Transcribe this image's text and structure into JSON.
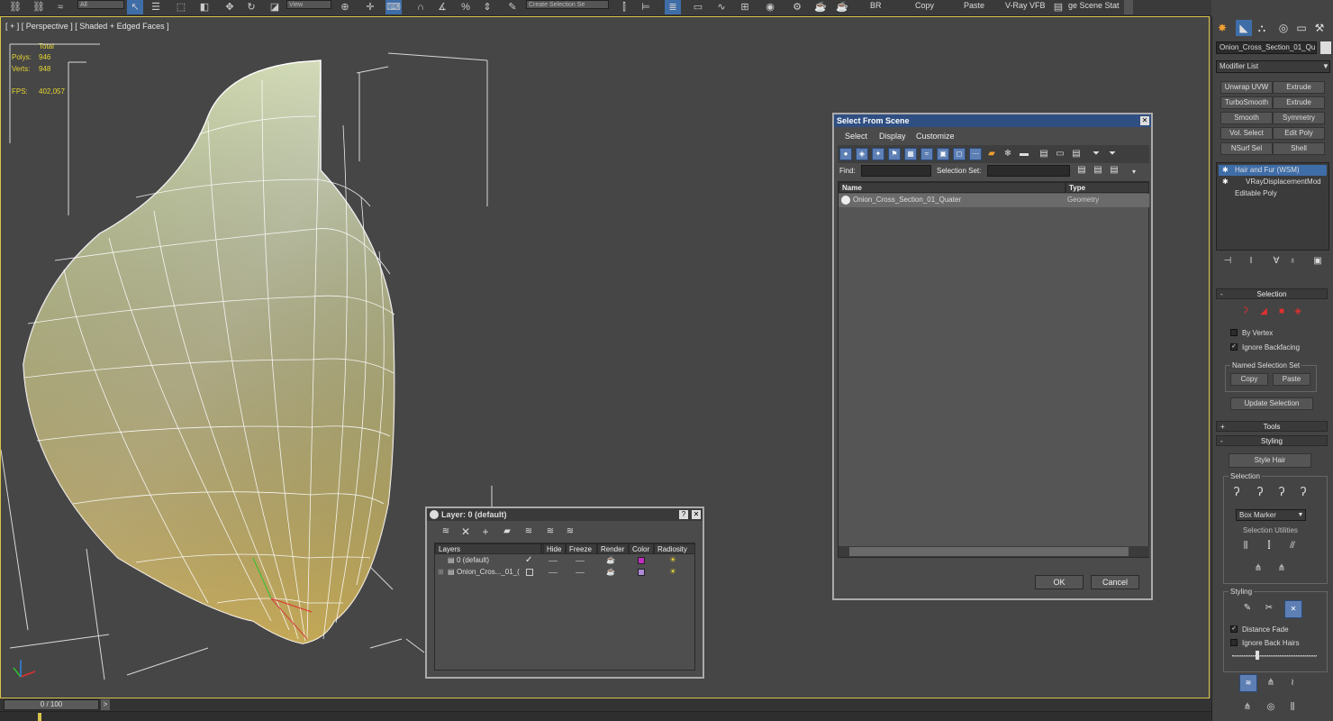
{
  "toolbar": {
    "filter_value": "All",
    "view_value": "View",
    "selection_set_placeholder": "Create Selection Se",
    "labels": [
      "BR",
      "Copy",
      "Paste",
      "V-Ray VFB",
      "ge Scene Stat"
    ]
  },
  "viewport": {
    "label": "[ + ] [ Perspective ] [ Shaded + Edged Faces ]",
    "stats": {
      "total_label": "Total",
      "polys_label": "Polys:",
      "polys_value": "946",
      "verts_label": "Verts:",
      "verts_value": "948",
      "fps_label": "FPS:",
      "fps_value": "402,057"
    }
  },
  "timeline": {
    "frame_display": "0 / 100",
    "next_label": ">",
    "prev_label": "<"
  },
  "command_panel": {
    "object_name": "Onion_Cross_Section_01_Qu",
    "modifier_list_label": "Modifier List",
    "modifier_buttons": [
      "Unwrap UVW",
      "Extrude",
      "TurboSmooth",
      "Extrude",
      "Smooth",
      "Symmetry",
      "Vol. Select",
      "Edit Poly",
      "NSurf Sel",
      "Shell"
    ],
    "stack": [
      "Hair and Fur (WSM)",
      "VRayDisplacementMod",
      "Editable Poly"
    ],
    "selection_rollout": {
      "title": "Selection",
      "sign": "-",
      "by_vertex": "By Vertex",
      "ignore_backfacing": "Ignore Backfacing",
      "named_selection_set": "Named Selection Set",
      "copy": "Copy",
      "paste": "Paste",
      "update_selection": "Update Selection"
    },
    "tools_rollout": {
      "title": "Tools",
      "sign": "+"
    },
    "styling_rollout": {
      "title": "Styling",
      "sign": "-",
      "style_hair": "Style Hair",
      "selection_group": "Selection",
      "box_marker": "Box Marker",
      "selection_utilities": "Selection Utilities",
      "styling_group": "Styling",
      "distance_fade": "Distance Fade",
      "ignore_back_hairs": "Ignore Back Hairs"
    }
  },
  "select_dialog": {
    "title": "Select From Scene",
    "close": "✕",
    "menu": [
      "Select",
      "Display",
      "Customize"
    ],
    "find_label": "Find:",
    "find_value": "",
    "selection_set_label": "Selection Set:",
    "selection_set_value": "",
    "columns": [
      "Name",
      "Type"
    ],
    "rows": [
      {
        "name": "Onion_Cross_Section_01_Quater",
        "type": "Geometry"
      }
    ],
    "ok": "OK",
    "cancel": "Cancel"
  },
  "layer_dialog": {
    "title": "Layer: 0 (default)",
    "help": "?",
    "close": "✕",
    "columns": [
      "Layers",
      "Hide",
      "Freeze",
      "Render",
      "Color",
      "Radiosity"
    ],
    "rows": [
      {
        "name": "0 (default)",
        "active": "✓",
        "color": "#c02cc0"
      },
      {
        "name": "Onion_Cros..._01_(",
        "active": "",
        "color": "#b08ad8"
      }
    ]
  },
  "colors": {
    "accent_blue": "#3e6da8",
    "viewport_border": "#d8c44a",
    "stats_yellow": "#e5d532",
    "title_bar": "#2f4f82"
  }
}
